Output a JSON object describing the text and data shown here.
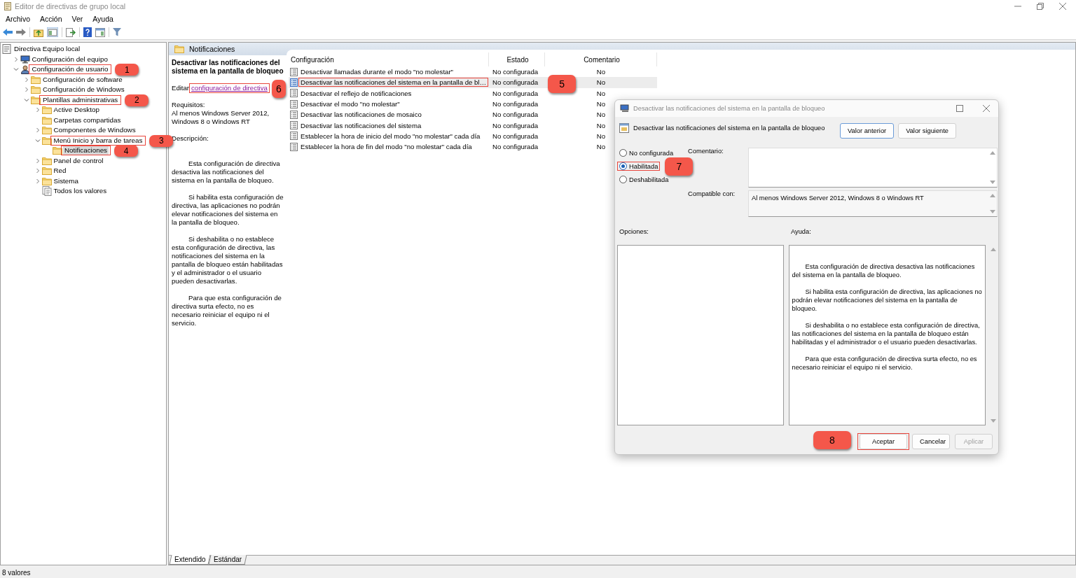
{
  "window": {
    "title": "Editor de directivas de grupo local"
  },
  "menu": [
    "Archivo",
    "Acción",
    "Ver",
    "Ayuda"
  ],
  "tree": {
    "label": "Directiva Equipo local",
    "kind": "policy",
    "selected": false,
    "children": [
      {
        "label": "Configuración del equipo",
        "kind": "computer",
        "expanded": false,
        "selected": false
      },
      {
        "label": "Configuración de usuario",
        "kind": "user",
        "expanded": true,
        "selected": false,
        "callout": "1",
        "children": [
          {
            "label": "Configuración de software",
            "kind": "folder",
            "expanded": false,
            "selected": false
          },
          {
            "label": "Configuración de Windows",
            "kind": "folder",
            "expanded": false,
            "selected": false
          },
          {
            "label": "Plantillas administrativas",
            "kind": "folder",
            "expanded": true,
            "selected": false,
            "callout": "2",
            "children": [
              {
                "label": "Active Desktop",
                "kind": "folder",
                "expanded": false,
                "selected": false
              },
              {
                "label": "Carpetas compartidas",
                "kind": "folder",
                "selected": false
              },
              {
                "label": "Componentes de Windows",
                "kind": "folder",
                "expanded": false,
                "selected": false
              },
              {
                "label": "Menú Inicio y barra de tareas",
                "kind": "folder",
                "expanded": true,
                "selected": false,
                "callout": "3",
                "children": [
                  {
                    "label": "Notificaciones",
                    "kind": "folder",
                    "selected": true,
                    "callout": "4"
                  }
                ]
              },
              {
                "label": "Panel de control",
                "kind": "folder",
                "expanded": false,
                "selected": false
              },
              {
                "label": "Red",
                "kind": "folder",
                "expanded": false,
                "selected": false
              },
              {
                "label": "Sistema",
                "kind": "folder",
                "expanded": false,
                "selected": false
              },
              {
                "label": "Todos los valores",
                "kind": "all",
                "selected": false
              }
            ]
          }
        ]
      }
    ]
  },
  "pane_header": "Notificaciones",
  "details": {
    "title": "Desactivar las notificaciones del sistema en la pantalla de bloqueo",
    "edit_prefix": "Editar",
    "edit_link": "configuración de directiva",
    "edit_callout": "6",
    "requirements_label": "Requisitos:",
    "requirements": "Al menos Windows Server 2012, Windows 8 o Windows RT",
    "description_label": "Descripción:",
    "description": [
      "Esta configuración de directiva desactiva las notificaciones del sistema en la pantalla de bloqueo.",
      "Si habilita esta configuración de directiva, las aplicaciones no podrán elevar notificaciones del sistema en la pantalla de bloqueo.",
      "Si deshabilita o no establece esta configuración de directiva, las notificaciones del sistema en la pantalla de bloqueo están habilitadas y el administrador o el usuario pueden desactivarlas.",
      "Para que esta configuración de directiva surta efecto, no es necesario reiniciar el equipo ni el servicio."
    ]
  },
  "table": {
    "columns": [
      "Configuración",
      "Estado",
      "Comentario"
    ],
    "rows": [
      {
        "setting": "Desactivar llamadas durante el modo \"no molestar\"",
        "state": "No configurada",
        "comment": "No",
        "selected": false
      },
      {
        "setting": "Desactivar las notificaciones del sistema en la pantalla de bl…",
        "state": "No configurada",
        "comment": "No",
        "selected": true,
        "callout": "5"
      },
      {
        "setting": "Desactivar el reflejo de notificaciones",
        "state": "No configurada",
        "comment": "No",
        "selected": false
      },
      {
        "setting": "Desactivar el modo \"no molestar\"",
        "state": "No configurada",
        "comment": "No",
        "selected": false
      },
      {
        "setting": "Desactivar las notificaciones de mosaico",
        "state": "No configurada",
        "comment": "No",
        "selected": false
      },
      {
        "setting": "Desactivar las notificaciones del sistema",
        "state": "No configurada",
        "comment": "No",
        "selected": false
      },
      {
        "setting": "Establecer la hora de inicio del modo \"no molestar\" cada día",
        "state": "No configurada",
        "comment": "No",
        "selected": false
      },
      {
        "setting": "Establecer la hora de fin del modo \"no molestar\" cada día",
        "state": "No configurada",
        "comment": "No",
        "selected": false
      }
    ]
  },
  "view_tabs": [
    {
      "label": "Extendido",
      "selected": true
    },
    {
      "label": "Estándar",
      "selected": false
    }
  ],
  "status_bar": "8 valores",
  "dialog": {
    "title": "Desactivar las notificaciones del sistema en la pantalla de bloqueo",
    "heading": "Desactivar las notificaciones del sistema en la pantalla de bloqueo",
    "nav_buttons": [
      "Valor anterior",
      "Valor siguiente"
    ],
    "options": [
      {
        "label": "No configurada",
        "selected": false
      },
      {
        "label": "Habilitada",
        "selected": true,
        "callout": "7"
      },
      {
        "label": "Deshabilitada",
        "selected": false
      }
    ],
    "comment_label": "Comentario:",
    "compatible_label": "Compatible con:",
    "compatible": "Al menos Windows Server 2012, Windows 8 o Windows RT",
    "options_label": "Opciones:",
    "help_label": "Ayuda:",
    "help": [
      "Esta configuración de directiva desactiva las notificaciones del sistema en la pantalla de bloqueo.",
      "Si habilita esta configuración de directiva, las aplicaciones no podrán elevar notificaciones del sistema en la pantalla de bloqueo.",
      "Si deshabilita o no establece esta configuración de directiva, las notificaciones del sistema en la pantalla de bloqueo están habilitadas y el administrador o el usuario pueden desactivarlas.",
      "Para que esta configuración de directiva surta efecto, no es necesario reiniciar el equipo ni el servicio."
    ],
    "buttons": [
      {
        "label": "Aceptar",
        "disabled": false,
        "callout": "8"
      },
      {
        "label": "Cancelar",
        "disabled": false
      },
      {
        "label": "Aplicar",
        "disabled": true
      }
    ]
  }
}
